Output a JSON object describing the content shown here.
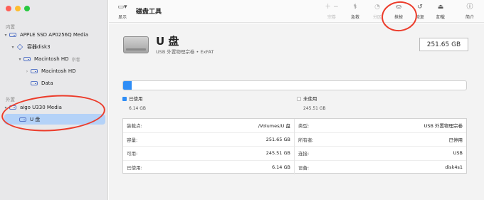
{
  "window": {
    "title": "磁盘工具"
  },
  "toolbar": {
    "view_label": "显示",
    "title": "磁盘工具",
    "items": [
      {
        "label": "宗卷",
        "icon": "plus-minus-icon",
        "disabled": true
      },
      {
        "label": "急救",
        "icon": "stethoscope-icon",
        "disabled": false
      },
      {
        "label": "分区",
        "icon": "pie-icon",
        "disabled": true
      },
      {
        "label": "抹掉",
        "icon": "erase-icon",
        "disabled": false
      },
      {
        "label": "恢复",
        "icon": "restore-icon",
        "disabled": false
      },
      {
        "label": "卸载",
        "icon": "eject-icon",
        "disabled": false
      },
      {
        "label": "简介",
        "icon": "info-icon",
        "disabled": false
      }
    ]
  },
  "sidebar": {
    "internal_label": "内置",
    "external_label": "外置",
    "items": [
      {
        "label": "APPLE SSD AP0256Q Media",
        "suffix": ""
      },
      {
        "label": "容器disk3",
        "suffix": ""
      },
      {
        "label": "Macintosh HD",
        "suffix": "宗卷"
      },
      {
        "label": "Macintosh HD",
        "suffix": ""
      },
      {
        "label": "Data",
        "suffix": ""
      },
      {
        "label": "aigo U330 Media",
        "suffix": ""
      },
      {
        "label": "U 盘",
        "suffix": ""
      }
    ]
  },
  "disk": {
    "name": "U 盘",
    "subtitle": "USB 外置物理宗卷 • ExFAT",
    "capacity": "251.65 GB"
  },
  "usage": {
    "used_fraction": 0.024,
    "used_color": "#2e8df6",
    "used_label": "已使用",
    "used_value": "6.14 GB",
    "free_label": "未使用",
    "free_value": "245.51 GB"
  },
  "info": {
    "left": [
      {
        "key": "装载点:",
        "value": "/Volumes/U 盘"
      },
      {
        "key": "容量:",
        "value": "251.65 GB"
      },
      {
        "key": "可用:",
        "value": "245.51 GB"
      },
      {
        "key": "已使用:",
        "value": "6.14 GB"
      }
    ],
    "right": [
      {
        "key": "类型:",
        "value": "USB 外置物理宗卷"
      },
      {
        "key": "所有者:",
        "value": "已停用"
      },
      {
        "key": "连接:",
        "value": "USB"
      },
      {
        "key": "设备:",
        "value": "disk4s1"
      }
    ]
  }
}
